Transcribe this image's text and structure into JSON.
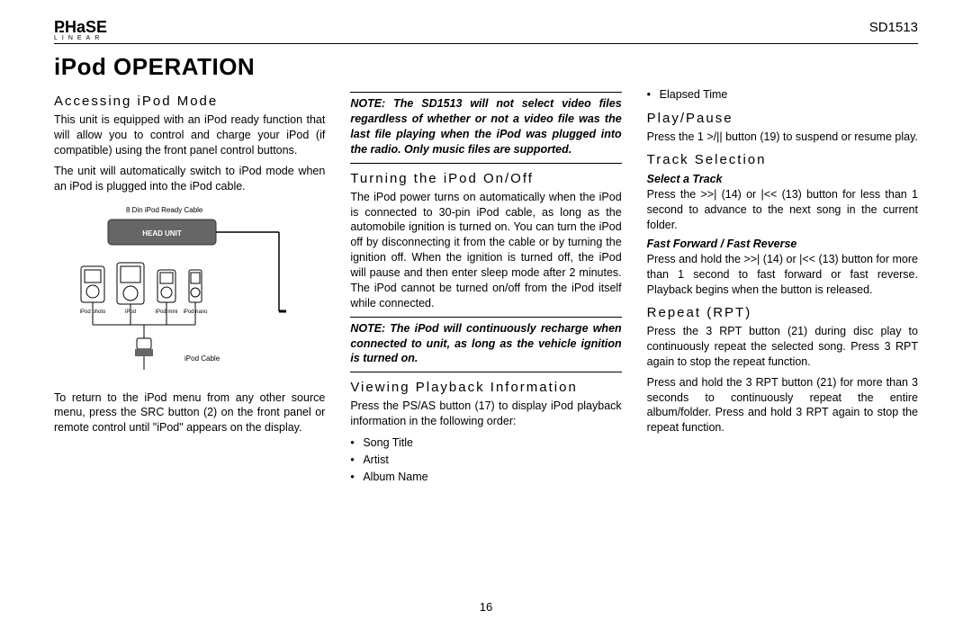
{
  "header": {
    "brand_main": "PHaSE",
    "brand_sub": "LINEAR",
    "model": "SD1513"
  },
  "title": "iPod OPERATION",
  "pagenum": "16",
  "col1": {
    "h1": "Accessing iPod Mode",
    "p1": "This unit is equipped with an iPod ready function that will allow you to control and charge your iPod (if compatible) using the front panel control buttons.",
    "p2": "The unit will automatically switch to iPod mode when an iPod is plugged into the iPod cable.",
    "p3": "To return to the iPod menu from any other source menu, press the SRC button (2) on the front panel or remote control until \"iPod\" appears on the display.",
    "diagram": {
      "cable_label": "8 Din iPod Ready Cable",
      "head_unit": "HEAD UNIT",
      "ipod_photo": "iPod photo",
      "ipod": "iPod",
      "ipod_mini": "iPod mini",
      "ipod_nano": "iPod nano",
      "ipod_cable": "iPod Cable"
    }
  },
  "col2": {
    "note1": "NOTE: The SD1513 will not select video files regardless of whether or not a video file was the last file playing when the iPod was plugged into the radio. Only music files are supported.",
    "h1": "Turning the iPod On/Off",
    "p1": "The iPod power turns on automatically when the iPod is connected to 30-pin iPod cable, as long as the automobile ignition is turned on. You can turn the iPod off by disconnecting it from the cable or by turning the ignition off. When the ignition is turned off, the iPod will pause and then enter sleep mode after 2 minutes. The iPod cannot be turned on/off from the iPod itself while connected.",
    "note2": "NOTE: The iPod will continuously recharge when connected to unit, as long as the vehicle ignition is turned on.",
    "h2": "Viewing Playback Information",
    "p2": "Press the PS/AS button (17) to display iPod playback information in the following order:",
    "list": [
      "Song Title",
      "Artist",
      "Album Name"
    ]
  },
  "col3": {
    "li0": "Elapsed Time",
    "h1": "Play/Pause",
    "p1": "Press the 1 >/|| button (19) to suspend or resume play.",
    "h2": "Track Selection",
    "sub1": "Select a Track",
    "p2": "Press the >>| (14) or |<< (13) button for less than 1 second to advance to the next song in the current folder.",
    "sub2": "Fast Forward / Fast Reverse",
    "p3": "Press and hold the >>| (14) or |<< (13) button for more than 1 second to fast forward or fast reverse. Playback begins when the button is released.",
    "h3": "Repeat (RPT)",
    "p4": "Press the 3 RPT button (21) during disc play to continuously repeat the selected song. Press 3 RPT again to stop the repeat function.",
    "p5": "Press and hold the 3 RPT button (21) for more than 3 seconds to continuously repeat the entire album/folder. Press and hold 3 RPT again to stop the repeat function."
  }
}
